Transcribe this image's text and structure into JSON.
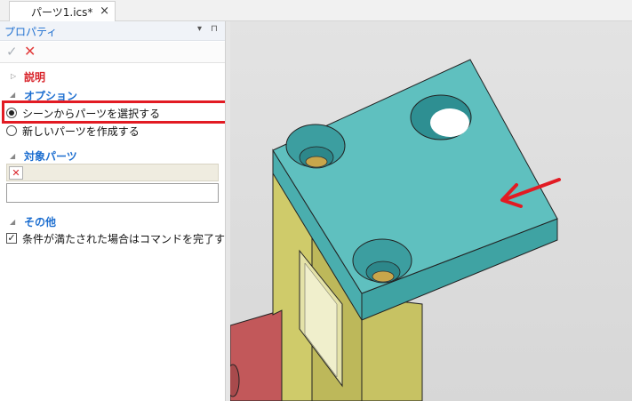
{
  "tab": {
    "title": "パーツ1.ics*",
    "close": "×"
  },
  "panel": {
    "title": "プロパティ",
    "pin_glyph": "▾",
    "pin2_glyph": "⊓",
    "ok_glyph": "✓",
    "cancel_glyph": "✕",
    "sections": {
      "description": {
        "title": "説明",
        "arrow": "▷"
      },
      "options": {
        "title": "オプション",
        "arrow": "◢",
        "items": [
          {
            "label": "シーンからパーツを選択する",
            "selected": true
          },
          {
            "label": "新しいパーツを作成する",
            "selected": false
          }
        ]
      },
      "target": {
        "title": "対象パーツ",
        "arrow": "◢",
        "clear_glyph": "✕",
        "value": ""
      },
      "other": {
        "title": "その他",
        "arrow": "◢",
        "checkbox_label": "条件が満たされた場合はコマンドを完了す...",
        "checked": true,
        "check_glyph": "✓"
      }
    }
  },
  "colors": {
    "accent_blue": "#1e6fd0",
    "title_red": "#d8232a",
    "highlight_red": "#e21b23",
    "block_teal": "#5fc0bf",
    "bracket_olive": "#cfcb6a",
    "base_red": "#c2585a"
  }
}
